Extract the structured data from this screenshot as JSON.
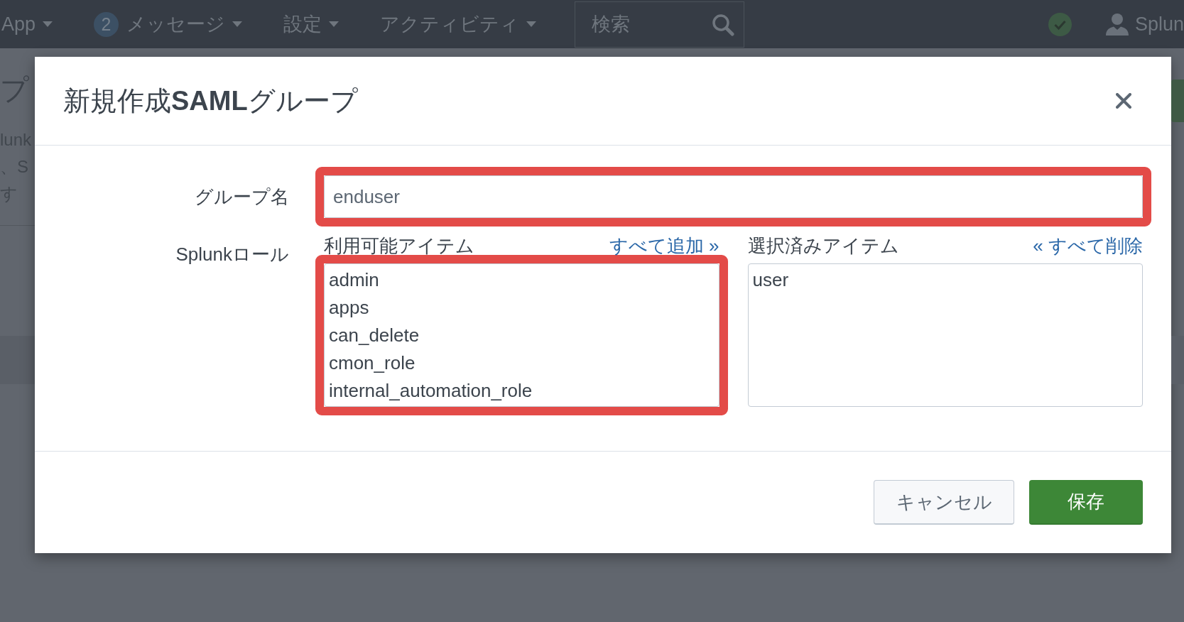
{
  "top_bar": {
    "nav": [
      {
        "label": "App"
      },
      {
        "label": "メッセージ",
        "badge": "2"
      },
      {
        "label": "設定"
      },
      {
        "label": "アクティビティ"
      }
    ],
    "search": {
      "placeholder": "検索"
    },
    "user": {
      "label": "Splun"
    }
  },
  "background_page": {
    "heading": "プ",
    "lines": [
      "lunk",
      "、S",
      "す"
    ]
  },
  "dialog": {
    "title": "新規作成**SAML**グループ",
    "fields": [
      {
        "kind": "text",
        "label": "グループ名",
        "value": "enduser",
        "highlighted": true
      },
      {
        "kind": "accumulator",
        "label": "Splunkロール",
        "available_list": {
          "heading": "利用可能アイテム",
          "action": "すべて追加 »",
          "highlighted": true,
          "items": [
            "admin",
            "apps",
            "can_delete",
            "cmon_role",
            "internal_automation_role"
          ]
        },
        "selected_list": {
          "heading": "選択済みアイテム",
          "action": "« すべて削除",
          "items": [
            "user"
          ]
        }
      }
    ],
    "buttons": [
      {
        "kind": "secondary",
        "label": "キャンセル"
      },
      {
        "kind": "primary",
        "label": "保存"
      }
    ]
  }
}
